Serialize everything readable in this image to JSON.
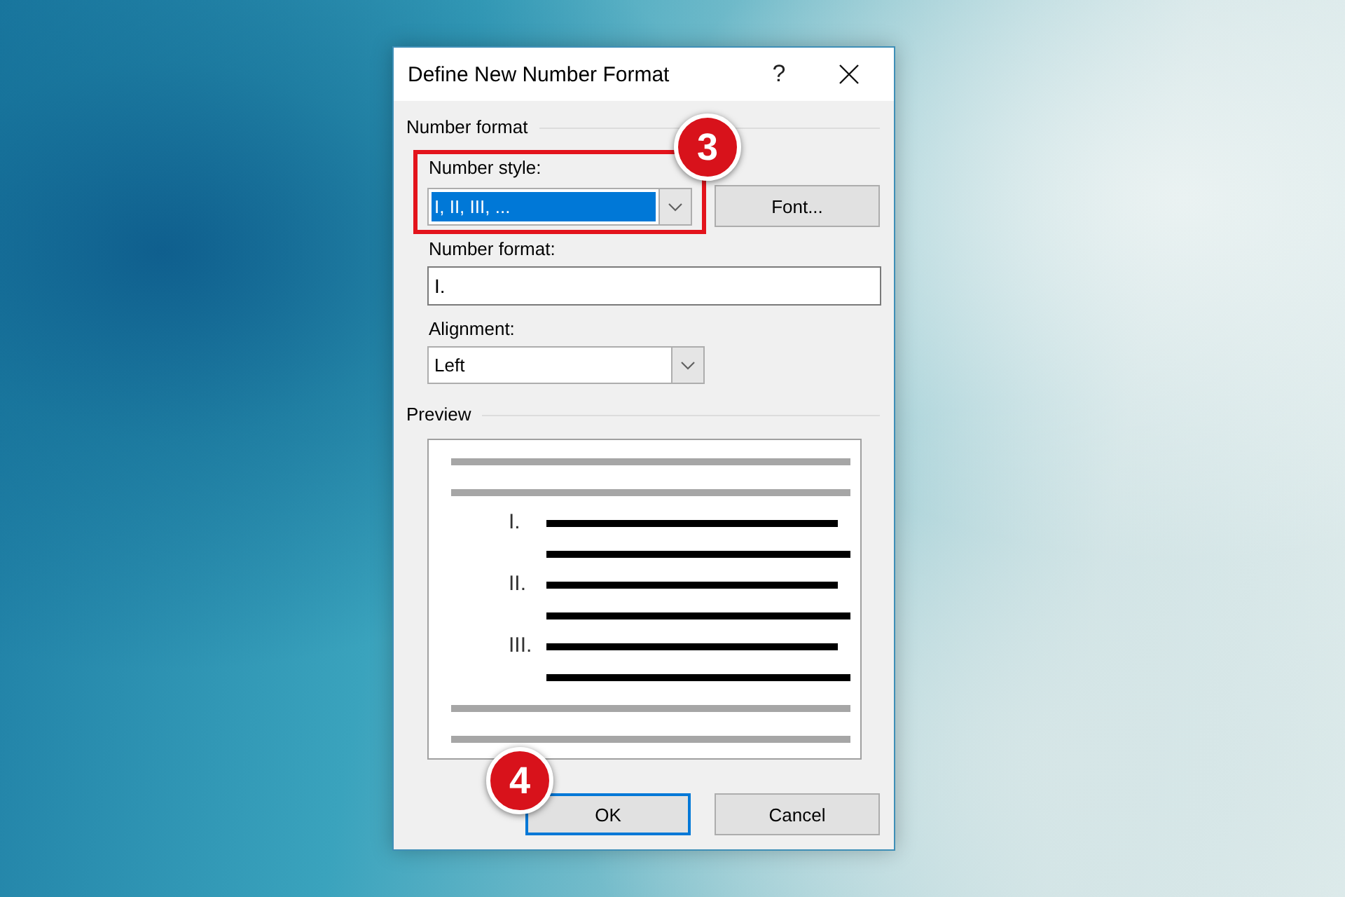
{
  "dialog": {
    "title": "Define New Number Format",
    "help": "?"
  },
  "number_format_group": {
    "heading": "Number format",
    "number_style": {
      "label": "Number style:",
      "value": "I, II, III, ...",
      "selected": true,
      "outlined": true,
      "callout": "3"
    },
    "font_button": {
      "label": "Font..."
    },
    "number_format": {
      "label": "Number format:",
      "value": "I."
    },
    "alignment": {
      "label": "Alignment:",
      "value": "Left"
    }
  },
  "preview": {
    "heading": "Preview",
    "items": [
      "I.",
      "II.",
      "III."
    ]
  },
  "buttons": [
    {
      "label": "OK",
      "default": true,
      "callout": "4"
    },
    {
      "label": "Cancel",
      "default": false
    }
  ]
}
